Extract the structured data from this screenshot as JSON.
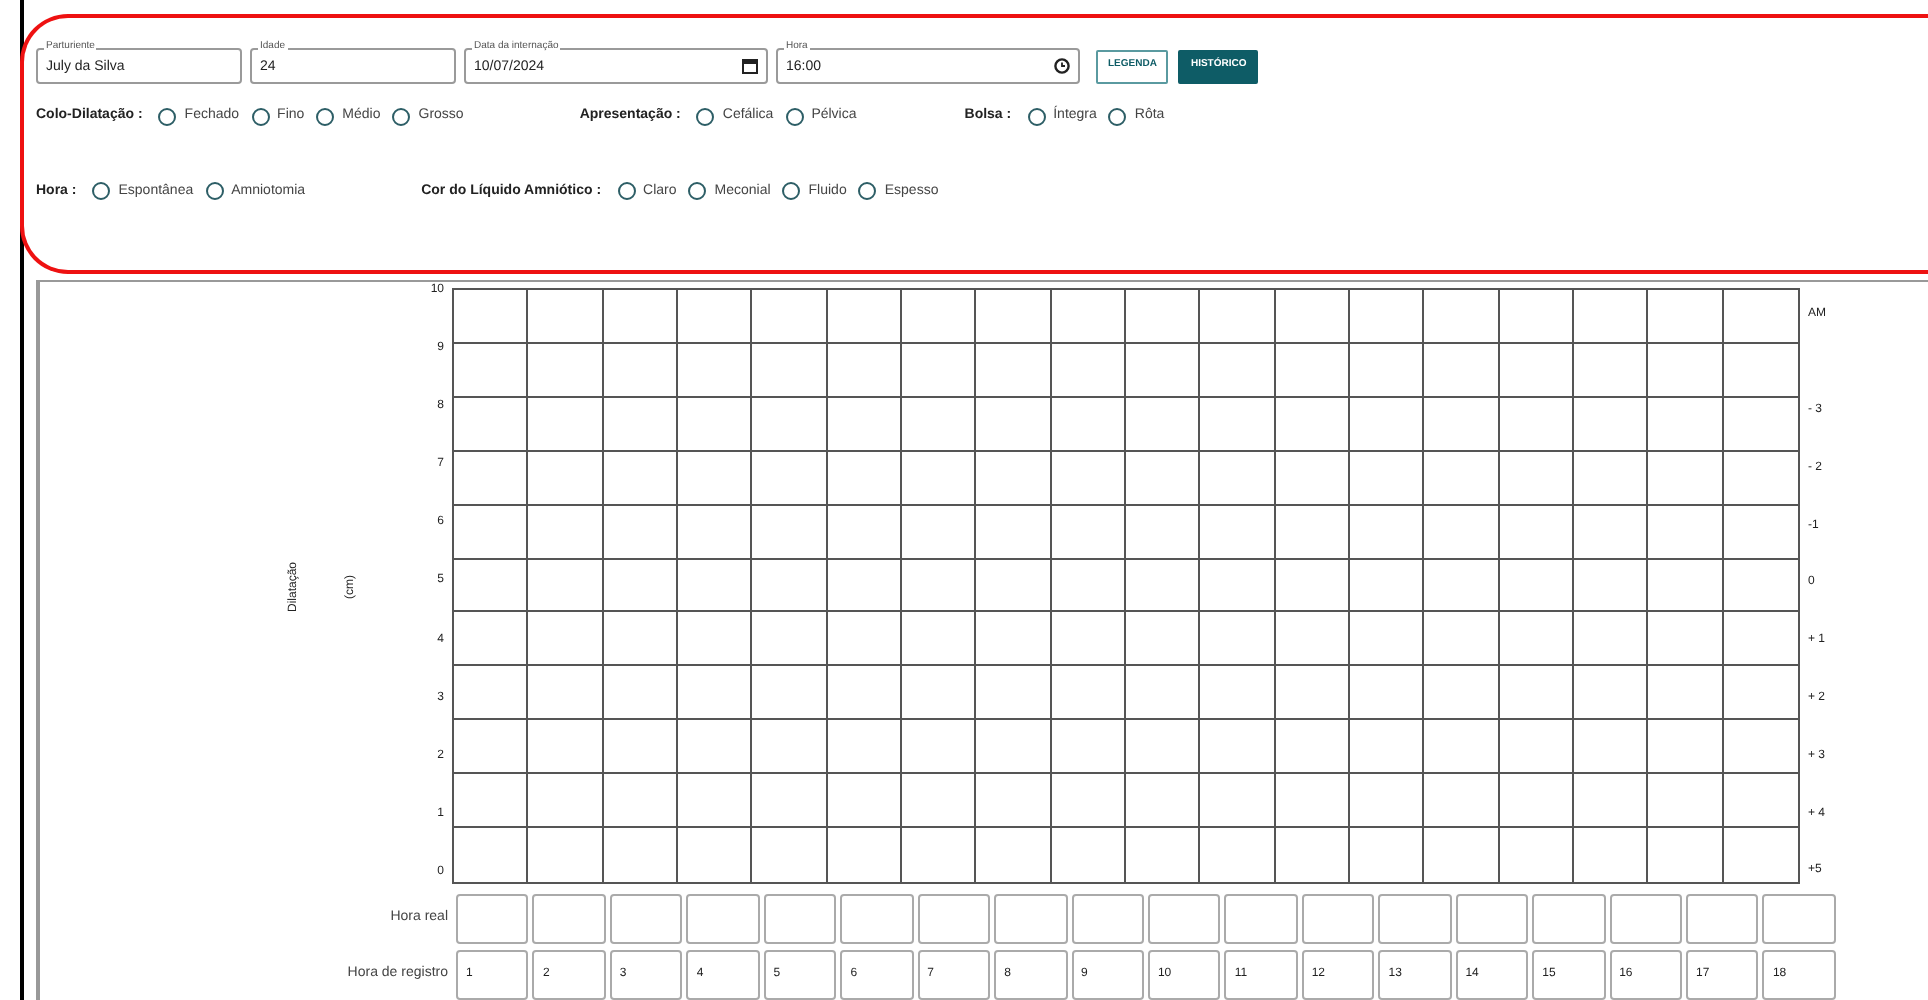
{
  "fields": [
    {
      "label": "Parturiente",
      "value": "July da Silva",
      "kind": "text"
    },
    {
      "label": "Idade",
      "value": "24",
      "kind": "text"
    },
    {
      "label": "Data da internação",
      "value": "10/07/2024",
      "kind": "date"
    },
    {
      "label": "Hora",
      "value": "16:00",
      "kind": "time"
    }
  ],
  "buttons": [
    {
      "label": "LEGENDA",
      "kind": "outline"
    },
    {
      "label": "HISTÓRICO",
      "kind": "filled"
    }
  ],
  "radio_rows": [
    [
      {
        "label": "Colo-Dilatação :",
        "options": [
          {
            "label": "Fechado",
            "selected": false
          },
          {
            "label": "Fino",
            "selected": false
          },
          {
            "label": "Médio",
            "selected": false
          },
          {
            "label": "Grosso",
            "selected": false
          }
        ]
      },
      {
        "label": "Apresentação :",
        "options": [
          {
            "label": "Cefálica",
            "selected": false
          },
          {
            "label": "Pélvica",
            "selected": false
          }
        ]
      },
      {
        "label": "Bolsa :",
        "options": [
          {
            "label": "Íntegra",
            "selected": false
          },
          {
            "label": "Rôta",
            "selected": false
          }
        ]
      }
    ],
    [
      {
        "label": "Hora :",
        "options": [
          {
            "label": "Espontânea",
            "selected": false
          },
          {
            "label": "Amniotomia",
            "selected": false
          }
        ]
      },
      {
        "label": "Cor do Líquido Amniótico :",
        "options": [
          {
            "label": "Claro",
            "selected": false
          },
          {
            "label": "Meconial",
            "selected": false
          },
          {
            "label": "Fluido",
            "selected": false
          },
          {
            "label": "Espesso",
            "selected": false
          }
        ]
      }
    ]
  ],
  "chart": {
    "ylabel": "Dilatação",
    "yunit": "(cm)",
    "left_ticks": [
      "10",
      "9",
      "8",
      "7",
      "6",
      "5",
      "4",
      "3",
      "2",
      "1",
      "0"
    ],
    "right_ticks": [
      "AM",
      "- 3",
      "- 2",
      "-1",
      "0",
      "+ 1",
      "+ 2",
      "+ 3",
      "+ 4",
      "+5"
    ]
  },
  "hora_real": {
    "label": "Hora real"
  },
  "hora_registro": {
    "label": "Hora de registro",
    "cells": [
      "1",
      "2",
      "3",
      "4",
      "5",
      "6",
      "7",
      "8",
      "9",
      "10",
      "11",
      "12",
      "13",
      "14",
      "15",
      "16",
      "17",
      "18"
    ]
  }
}
